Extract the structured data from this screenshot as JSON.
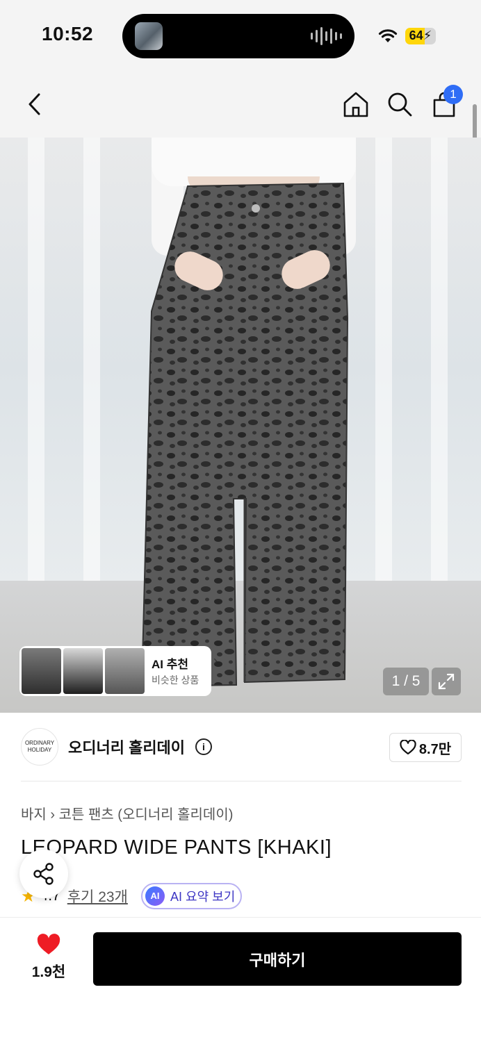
{
  "status_bar": {
    "time": "10:52",
    "battery": "64",
    "battery_level": 0.64
  },
  "nav": {
    "cart_count": "1",
    "icons": [
      "back-arrow-icon",
      "home-icon",
      "search-icon",
      "cart-icon"
    ]
  },
  "gallery": {
    "pager": "1 / 5",
    "ai_recommend": {
      "title": "AI 추천",
      "subtitle": "비슷한 상품"
    }
  },
  "brand": {
    "logo_line1": "ORDINARY",
    "logo_line2": "HOLIDAY",
    "name": "오디너리 홀리데이",
    "likes": "8.7만"
  },
  "product": {
    "breadcrumb_category": "바지",
    "breadcrumb_sub": "코튼 팬츠 (오디너리 홀리데이)",
    "title": "LEOPARD WIDE PANTS [KHAKI]",
    "rating": "4.7",
    "reviews": "후기 23개",
    "ai_summary_chip": "AI",
    "ai_summary": "AI 요약 보기"
  },
  "bottom_bar": {
    "wish_count": "1.9천",
    "buy_label": "구매하기"
  },
  "colors": {
    "accent_blue": "#2f6df6",
    "wish_red": "#ee1c25",
    "star": "#f7b500",
    "buy_bg": "#000000"
  }
}
